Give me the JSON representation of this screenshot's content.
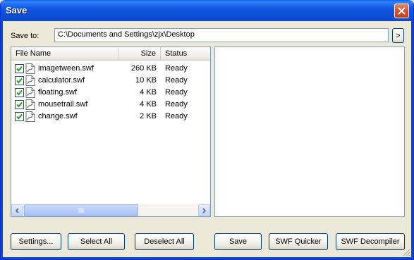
{
  "window": {
    "title": "Save"
  },
  "save_to": {
    "label": "Save to:",
    "path": "C:\\Documents and Settings\\zjx\\Desktop",
    "browse_label": ">"
  },
  "file_list": {
    "columns": {
      "name": "File Name",
      "size": "Size",
      "status": "Status"
    },
    "rows": [
      {
        "name": "imagetween.swf",
        "size": "260 KB",
        "status": "Ready",
        "checked": true
      },
      {
        "name": "calculator.swf",
        "size": "10 KB",
        "status": "Ready",
        "checked": true
      },
      {
        "name": "floating.swf",
        "size": "4 KB",
        "status": "Ready",
        "checked": true
      },
      {
        "name": "mousetrail.swf",
        "size": "4 KB",
        "status": "Ready",
        "checked": true
      },
      {
        "name": "change.swf",
        "size": "2 KB",
        "status": "Ready",
        "checked": true
      }
    ]
  },
  "buttons": {
    "settings": "Settings...",
    "select_all": "Select All",
    "deselect_all": "Deselect All",
    "save": "Save",
    "swf_quicker": "SWF Quicker",
    "swf_decompiler": "SWF Decompiler"
  },
  "icons": {
    "close": "close-icon",
    "file": "swf-file-icon",
    "check": "checkmark-icon",
    "scroll_left": "chevron-left-icon",
    "scroll_right": "chevron-right-icon",
    "resize_grip": "resize-grip-icon"
  },
  "colors": {
    "titlebar": "#0b48c9",
    "close_button": "#d9502e",
    "dialog_bg": "#ece9d8"
  }
}
